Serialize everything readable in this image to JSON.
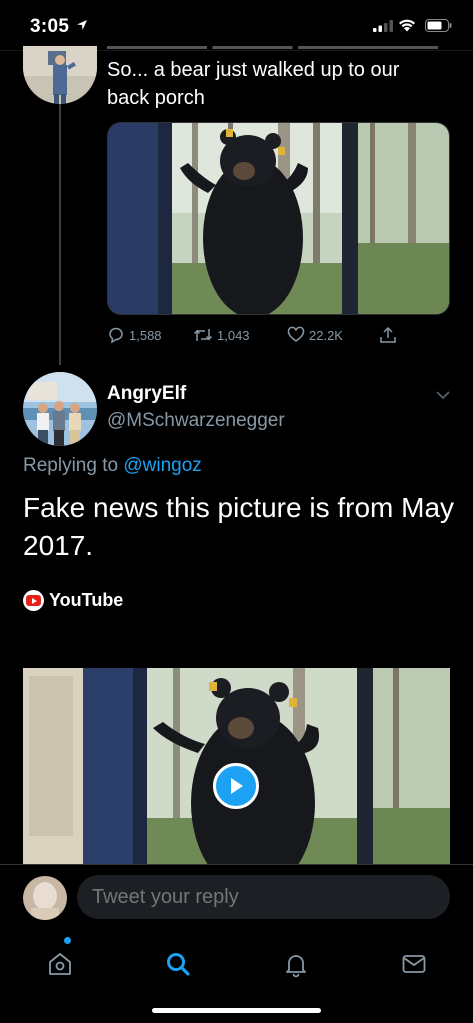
{
  "status_bar": {
    "time": "3:05"
  },
  "parent_tweet": {
    "text": "So... a bear just walked up to our back porch",
    "reply_count": "1,588",
    "retweet_count": "1,043",
    "like_count": "22.2K"
  },
  "main_tweet": {
    "display_name": "AngryElf",
    "handle": "@MSchwarzenegger",
    "replying_prefix": "Replying to",
    "replying_to": "@wingoz",
    "text": "Fake news this picture is from May 2017.",
    "link_source": "YouTube"
  },
  "reply_bar": {
    "placeholder": "Tweet your reply"
  },
  "tab_bar": {
    "items": [
      "home-icon",
      "search-icon",
      "notifications-icon",
      "messages-icon"
    ],
    "active": "search-icon"
  },
  "colors": {
    "accent": "#1da1f2",
    "muted": "#8899a6",
    "background": "#000000",
    "youtube_red": "#e62117"
  }
}
